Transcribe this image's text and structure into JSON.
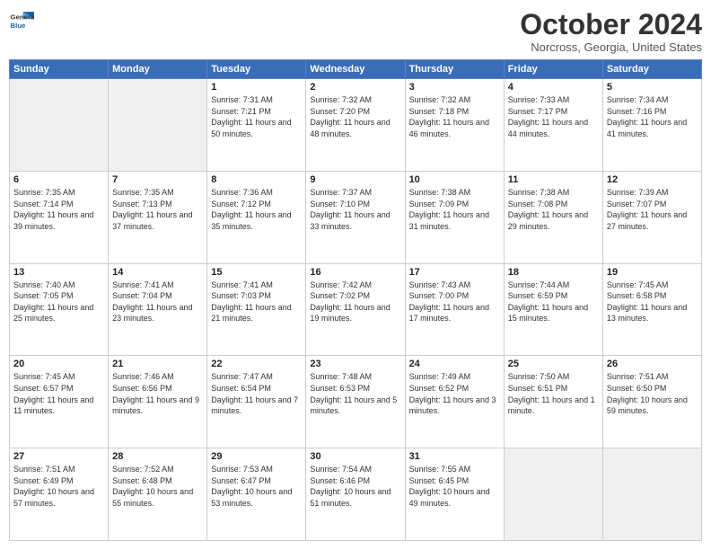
{
  "header": {
    "logo_line1": "General",
    "logo_line2": "Blue",
    "month": "October 2024",
    "location": "Norcross, Georgia, United States"
  },
  "weekdays": [
    "Sunday",
    "Monday",
    "Tuesday",
    "Wednesday",
    "Thursday",
    "Friday",
    "Saturday"
  ],
  "weeks": [
    [
      {
        "day": "",
        "sunrise": "",
        "sunset": "",
        "daylight": ""
      },
      {
        "day": "",
        "sunrise": "",
        "sunset": "",
        "daylight": ""
      },
      {
        "day": "1",
        "sunrise": "Sunrise: 7:31 AM",
        "sunset": "Sunset: 7:21 PM",
        "daylight": "Daylight: 11 hours and 50 minutes."
      },
      {
        "day": "2",
        "sunrise": "Sunrise: 7:32 AM",
        "sunset": "Sunset: 7:20 PM",
        "daylight": "Daylight: 11 hours and 48 minutes."
      },
      {
        "day": "3",
        "sunrise": "Sunrise: 7:32 AM",
        "sunset": "Sunset: 7:18 PM",
        "daylight": "Daylight: 11 hours and 46 minutes."
      },
      {
        "day": "4",
        "sunrise": "Sunrise: 7:33 AM",
        "sunset": "Sunset: 7:17 PM",
        "daylight": "Daylight: 11 hours and 44 minutes."
      },
      {
        "day": "5",
        "sunrise": "Sunrise: 7:34 AM",
        "sunset": "Sunset: 7:16 PM",
        "daylight": "Daylight: 11 hours and 41 minutes."
      }
    ],
    [
      {
        "day": "6",
        "sunrise": "Sunrise: 7:35 AM",
        "sunset": "Sunset: 7:14 PM",
        "daylight": "Daylight: 11 hours and 39 minutes."
      },
      {
        "day": "7",
        "sunrise": "Sunrise: 7:35 AM",
        "sunset": "Sunset: 7:13 PM",
        "daylight": "Daylight: 11 hours and 37 minutes."
      },
      {
        "day": "8",
        "sunrise": "Sunrise: 7:36 AM",
        "sunset": "Sunset: 7:12 PM",
        "daylight": "Daylight: 11 hours and 35 minutes."
      },
      {
        "day": "9",
        "sunrise": "Sunrise: 7:37 AM",
        "sunset": "Sunset: 7:10 PM",
        "daylight": "Daylight: 11 hours and 33 minutes."
      },
      {
        "day": "10",
        "sunrise": "Sunrise: 7:38 AM",
        "sunset": "Sunset: 7:09 PM",
        "daylight": "Daylight: 11 hours and 31 minutes."
      },
      {
        "day": "11",
        "sunrise": "Sunrise: 7:38 AM",
        "sunset": "Sunset: 7:08 PM",
        "daylight": "Daylight: 11 hours and 29 minutes."
      },
      {
        "day": "12",
        "sunrise": "Sunrise: 7:39 AM",
        "sunset": "Sunset: 7:07 PM",
        "daylight": "Daylight: 11 hours and 27 minutes."
      }
    ],
    [
      {
        "day": "13",
        "sunrise": "Sunrise: 7:40 AM",
        "sunset": "Sunset: 7:05 PM",
        "daylight": "Daylight: 11 hours and 25 minutes."
      },
      {
        "day": "14",
        "sunrise": "Sunrise: 7:41 AM",
        "sunset": "Sunset: 7:04 PM",
        "daylight": "Daylight: 11 hours and 23 minutes."
      },
      {
        "day": "15",
        "sunrise": "Sunrise: 7:41 AM",
        "sunset": "Sunset: 7:03 PM",
        "daylight": "Daylight: 11 hours and 21 minutes."
      },
      {
        "day": "16",
        "sunrise": "Sunrise: 7:42 AM",
        "sunset": "Sunset: 7:02 PM",
        "daylight": "Daylight: 11 hours and 19 minutes."
      },
      {
        "day": "17",
        "sunrise": "Sunrise: 7:43 AM",
        "sunset": "Sunset: 7:00 PM",
        "daylight": "Daylight: 11 hours and 17 minutes."
      },
      {
        "day": "18",
        "sunrise": "Sunrise: 7:44 AM",
        "sunset": "Sunset: 6:59 PM",
        "daylight": "Daylight: 11 hours and 15 minutes."
      },
      {
        "day": "19",
        "sunrise": "Sunrise: 7:45 AM",
        "sunset": "Sunset: 6:58 PM",
        "daylight": "Daylight: 11 hours and 13 minutes."
      }
    ],
    [
      {
        "day": "20",
        "sunrise": "Sunrise: 7:45 AM",
        "sunset": "Sunset: 6:57 PM",
        "daylight": "Daylight: 11 hours and 11 minutes."
      },
      {
        "day": "21",
        "sunrise": "Sunrise: 7:46 AM",
        "sunset": "Sunset: 6:56 PM",
        "daylight": "Daylight: 11 hours and 9 minutes."
      },
      {
        "day": "22",
        "sunrise": "Sunrise: 7:47 AM",
        "sunset": "Sunset: 6:54 PM",
        "daylight": "Daylight: 11 hours and 7 minutes."
      },
      {
        "day": "23",
        "sunrise": "Sunrise: 7:48 AM",
        "sunset": "Sunset: 6:53 PM",
        "daylight": "Daylight: 11 hours and 5 minutes."
      },
      {
        "day": "24",
        "sunrise": "Sunrise: 7:49 AM",
        "sunset": "Sunset: 6:52 PM",
        "daylight": "Daylight: 11 hours and 3 minutes."
      },
      {
        "day": "25",
        "sunrise": "Sunrise: 7:50 AM",
        "sunset": "Sunset: 6:51 PM",
        "daylight": "Daylight: 11 hours and 1 minute."
      },
      {
        "day": "26",
        "sunrise": "Sunrise: 7:51 AM",
        "sunset": "Sunset: 6:50 PM",
        "daylight": "Daylight: 10 hours and 59 minutes."
      }
    ],
    [
      {
        "day": "27",
        "sunrise": "Sunrise: 7:51 AM",
        "sunset": "Sunset: 6:49 PM",
        "daylight": "Daylight: 10 hours and 57 minutes."
      },
      {
        "day": "28",
        "sunrise": "Sunrise: 7:52 AM",
        "sunset": "Sunset: 6:48 PM",
        "daylight": "Daylight: 10 hours and 55 minutes."
      },
      {
        "day": "29",
        "sunrise": "Sunrise: 7:53 AM",
        "sunset": "Sunset: 6:47 PM",
        "daylight": "Daylight: 10 hours and 53 minutes."
      },
      {
        "day": "30",
        "sunrise": "Sunrise: 7:54 AM",
        "sunset": "Sunset: 6:46 PM",
        "daylight": "Daylight: 10 hours and 51 minutes."
      },
      {
        "day": "31",
        "sunrise": "Sunrise: 7:55 AM",
        "sunset": "Sunset: 6:45 PM",
        "daylight": "Daylight: 10 hours and 49 minutes."
      },
      {
        "day": "",
        "sunrise": "",
        "sunset": "",
        "daylight": ""
      },
      {
        "day": "",
        "sunrise": "",
        "sunset": "",
        "daylight": ""
      }
    ]
  ]
}
